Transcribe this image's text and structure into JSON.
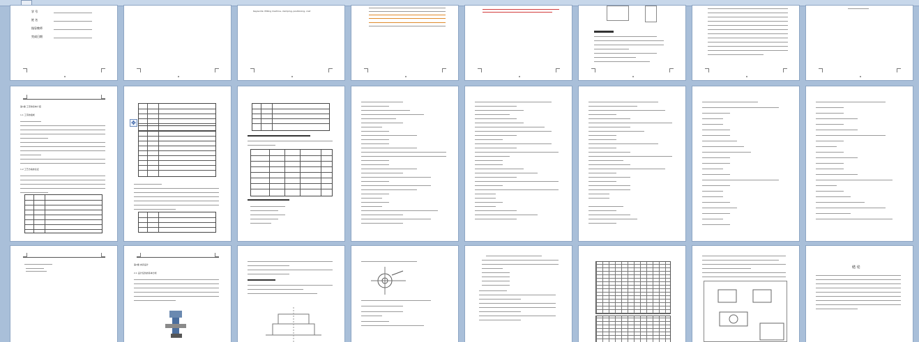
{
  "window": {
    "view": "multi-page print preview"
  },
  "pages": {
    "p1": {
      "labels": [
        "学 号",
        "姓 名",
        "指导教师",
        "完成日期"
      ]
    },
    "p3": {
      "keywords": "Keywords: Milling machine, clamping, positioning, cost"
    },
    "p9": {
      "chapter": "第1章 工序的基本介绍",
      "section1": "1.1 工序的组成",
      "section2": "1.2 工艺方案的论证"
    },
    "p17": {
      "chapter": "第2章 夹具设计",
      "section": "2.1 设计任务的基本分析"
    },
    "p24": {
      "title": "结 论"
    }
  },
  "icons": {
    "move_handle": "move-handle-icon",
    "scroll_thumb": "scroll-thumb"
  },
  "colors": {
    "background": "#a9bfd9",
    "accent_red": "#d23c3c",
    "accent_orange": "#e08a2a"
  }
}
